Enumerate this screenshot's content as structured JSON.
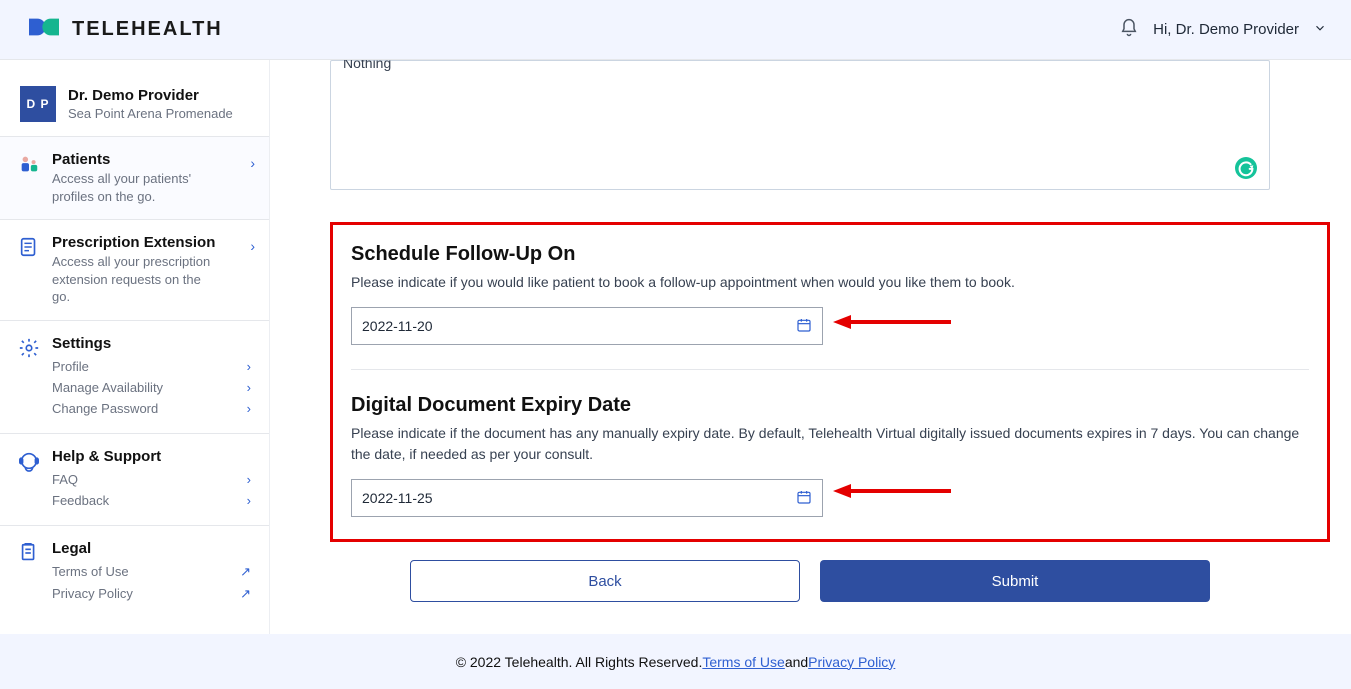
{
  "header": {
    "logo_text": "TELEHEALTH",
    "greeting": "Hi, Dr. Demo  Provider"
  },
  "sidebar": {
    "avatar_initials": "D P",
    "profile_name": "Dr. Demo Provider",
    "profile_location": "Sea Point Arena Promenade",
    "sections": {
      "patients": {
        "title": "Patients",
        "desc": "Access all your patients' profiles on the go."
      },
      "prescription": {
        "title": "Prescription Extension",
        "desc": "Access all your prescription extension requests on the go."
      },
      "settings": {
        "title": "Settings",
        "items": [
          "Profile",
          "Manage Availability",
          "Change Password"
        ]
      },
      "help": {
        "title": "Help & Support",
        "items": [
          "FAQ",
          "Feedback"
        ]
      },
      "legal": {
        "title": "Legal",
        "items": [
          "Terms of Use",
          "Privacy Policy"
        ]
      }
    }
  },
  "main": {
    "textarea_value": "Nothing",
    "followup": {
      "title": "Schedule Follow-Up On",
      "desc": "Please indicate if you would like patient to book a follow-up appointment when would you like them to book.",
      "value": "2022-11-20"
    },
    "expiry": {
      "title": "Digital Document Expiry Date",
      "desc": "Please indicate if the document has any manually expiry date. By default, Telehealth Virtual digitally issued documents expires in 7 days. You can change the date, if needed as per your consult.",
      "value": "2022-11-25"
    },
    "back_label": "Back",
    "submit_label": "Submit"
  },
  "footer": {
    "copyright": "© 2022 Telehealth. All Rights Reserved.",
    "terms": "Terms of Use",
    "and": " and ",
    "privacy": "Privacy Policy"
  },
  "colors": {
    "accent": "#2e4ea0",
    "link": "#2e5fd1",
    "highlight": "#e40000"
  }
}
